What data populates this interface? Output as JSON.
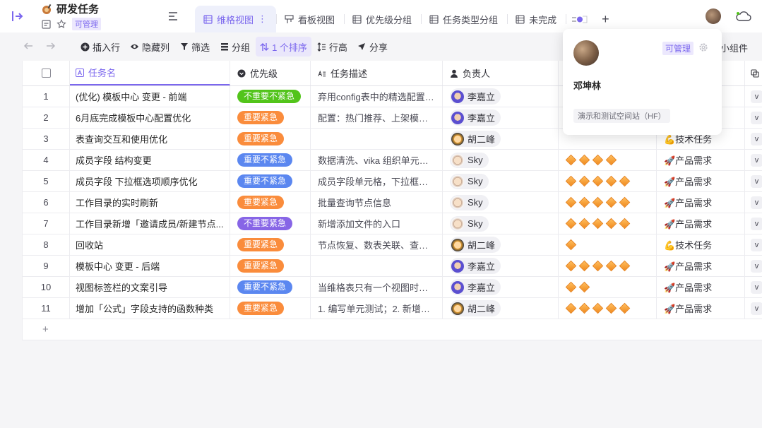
{
  "app": {
    "title": "研发任务",
    "permission": "可管理"
  },
  "tabs": [
    {
      "label": "维格视图",
      "icon": "grid-view-icon",
      "active": true
    },
    {
      "label": "看板视图",
      "icon": "kanban-icon",
      "active": false
    },
    {
      "label": "优先级分组",
      "icon": "grid-view-icon",
      "active": false
    },
    {
      "label": "任务类型分组",
      "icon": "grid-view-icon",
      "active": false
    },
    {
      "label": "未完成",
      "icon": "grid-view-icon",
      "active": false
    }
  ],
  "toolbar": {
    "insert_row": "插入行",
    "hide_columns": "隐藏列",
    "filter": "筛选",
    "group": "分组",
    "sort": "1 个排序",
    "row_height": "行高",
    "share": "分享",
    "widgets": "小组件"
  },
  "columns": {
    "task_name": "任务名",
    "priority": "优先级",
    "description": "任务描述",
    "assignee": "负责人"
  },
  "colors": {
    "accent": "#7b67ee",
    "priority_green": "#52c41a",
    "priority_orange": "#fa8c3c",
    "priority_blue": "#5b87f0",
    "priority_purple": "#8765e6"
  },
  "rows": [
    {
      "no": "1",
      "name": "(优化) 模板中心 变更 - 前端",
      "priority": "不重要不紧急",
      "priority_color": "#52c41a",
      "desc": "弃用config表中的精选配置，...",
      "assignee": "李嘉立",
      "avatar": "avatar-li",
      "stars": 0,
      "type": ""
    },
    {
      "no": "2",
      "name": "6月底完成模板中心配置优化",
      "priority": "重要紧急",
      "priority_color": "#fa8c3c",
      "desc": "配置：热门推荐、上架模板 v...",
      "assignee": "李嘉立",
      "avatar": "avatar-li",
      "stars": 0,
      "type": ""
    },
    {
      "no": "3",
      "name": "表查询交互和使用优化",
      "priority": "重要紧急",
      "priority_color": "#fa8c3c",
      "desc": "",
      "assignee": "胡二峰",
      "avatar": "avatar-hu",
      "stars": 0,
      "type": "💪技术任务"
    },
    {
      "no": "4",
      "name": "成员字段 结构变更",
      "priority": "重要不紧急",
      "priority_color": "#5b87f0",
      "desc": "数据清洗、vika 组织单元的...",
      "assignee": "Sky",
      "avatar": "avatar-sky",
      "stars": 4,
      "type": "🚀产品需求"
    },
    {
      "no": "5",
      "name": "成员字段 下拉框选项顺序优化",
      "priority": "重要不紧急",
      "priority_color": "#5b87f0",
      "desc": "成员字段单元格，下拉框选...",
      "assignee": "Sky",
      "avatar": "avatar-sky",
      "stars": 5,
      "type": "🚀产品需求"
    },
    {
      "no": "6",
      "name": "工作目录的实时刷新",
      "priority": "重要紧急",
      "priority_color": "#fa8c3c",
      "desc": "批量查询节点信息",
      "assignee": "Sky",
      "avatar": "avatar-sky",
      "stars": 5,
      "type": "🚀产品需求"
    },
    {
      "no": "7",
      "name": "工作目录新增「邀请成员/新建节点...",
      "priority": "不重要紧急",
      "priority_color": "#8765e6",
      "desc": "新增添加文件的入口",
      "assignee": "Sky",
      "avatar": "avatar-sky",
      "stars": 5,
      "type": "🚀产品需求"
    },
    {
      "no": "8",
      "name": "回收站",
      "priority": "重要紧急",
      "priority_color": "#fa8c3c",
      "desc": "节点恢复、数表关联、查询...",
      "assignee": "胡二峰",
      "avatar": "avatar-hu",
      "stars": 1,
      "type": "💪技术任务"
    },
    {
      "no": "9",
      "name": "模板中心 变更 - 后端",
      "priority": "重要紧急",
      "priority_color": "#fa8c3c",
      "desc": "",
      "assignee": "李嘉立",
      "avatar": "avatar-li",
      "stars": 5,
      "type": "🚀产品需求"
    },
    {
      "no": "10",
      "name": "视图标签栏的文案引导",
      "priority": "重要不紧急",
      "priority_color": "#5b87f0",
      "desc": "当维格表只有一个视图时，...",
      "assignee": "李嘉立",
      "avatar": "avatar-li",
      "stars": 2,
      "type": "🚀产品需求"
    },
    {
      "no": "11",
      "name": "增加「公式」字段支持的函数种类",
      "priority": "重要紧急",
      "priority_color": "#fa8c3c",
      "desc": "1. 编写单元测试；2. 新增公...",
      "assignee": "胡二峰",
      "avatar": "avatar-hu",
      "stars": 5,
      "type": "🚀产品需求"
    }
  ],
  "last_col_stub": "v",
  "add_row_label": "+",
  "popover": {
    "name": "邓坤林",
    "permission": "可管理",
    "space": "演示和测试空间站（HF）"
  }
}
